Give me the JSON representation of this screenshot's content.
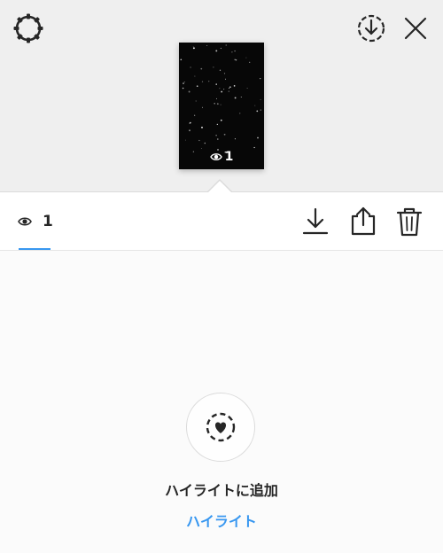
{
  "header": {
    "settings_icon": "settings-gear-icon",
    "download_icon": "download-circle-icon",
    "close_icon": "close-x-icon"
  },
  "story_preview": {
    "views_count": "1",
    "views_icon": "eye-icon"
  },
  "toolbar": {
    "viewers_count": "1",
    "viewers_icon": "eye-icon",
    "tools": [
      "save-icon",
      "share-icon",
      "trash-icon"
    ]
  },
  "highlight": {
    "icon": "heart-dashed-circle-icon",
    "title": "ハイライトに追加",
    "link": "ハイライト"
  },
  "colors": {
    "accent": "#3897f0",
    "header_bg": "#efefef",
    "text": "#262626"
  }
}
